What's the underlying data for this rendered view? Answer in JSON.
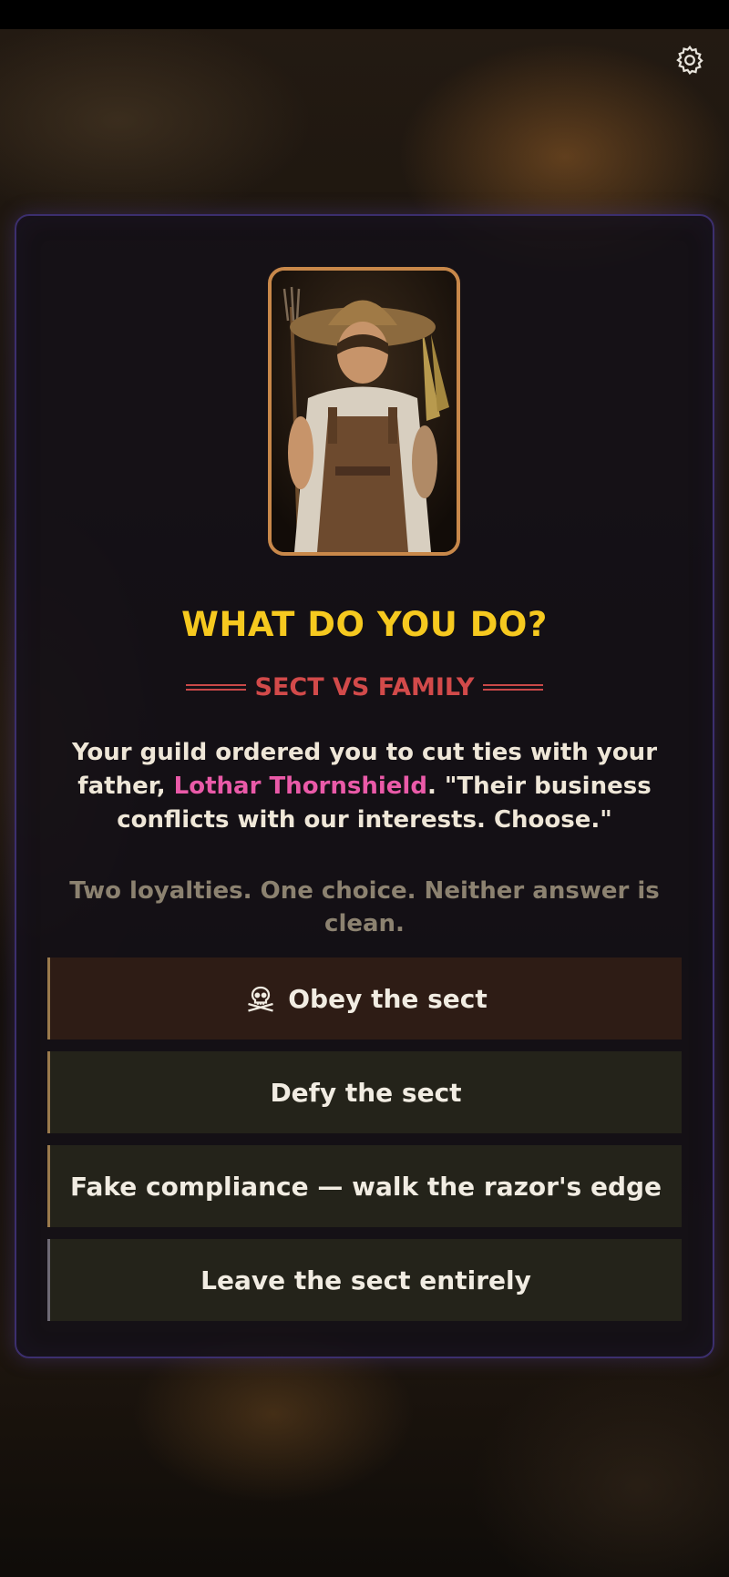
{
  "header": {
    "settings_icon": "gear-icon"
  },
  "event": {
    "title": "WHAT DO YOU DO?",
    "subtitle": "SECT VS FAMILY",
    "story_before": "Your guild ordered you to cut ties with your father, ",
    "npc_name": "Lothar Thornshield",
    "story_after": ". \"Their business conflicts with our interests. Choose.\"",
    "flavor": "Two loyalties. One choice. Neither answer is clean."
  },
  "choices": [
    {
      "label": "Obey the sect",
      "icon": "skull-crossbones-icon"
    },
    {
      "label": "Defy the sect"
    },
    {
      "label": "Fake compliance — walk the razor's edge"
    },
    {
      "label": "Leave the sect entirely"
    }
  ],
  "colors": {
    "title": "#f6c91f",
    "subtitle": "#d24a4a",
    "npc_name": "#ea5aa8",
    "panel_border": "#3c2f6e",
    "portrait_border": "#c8884a"
  }
}
